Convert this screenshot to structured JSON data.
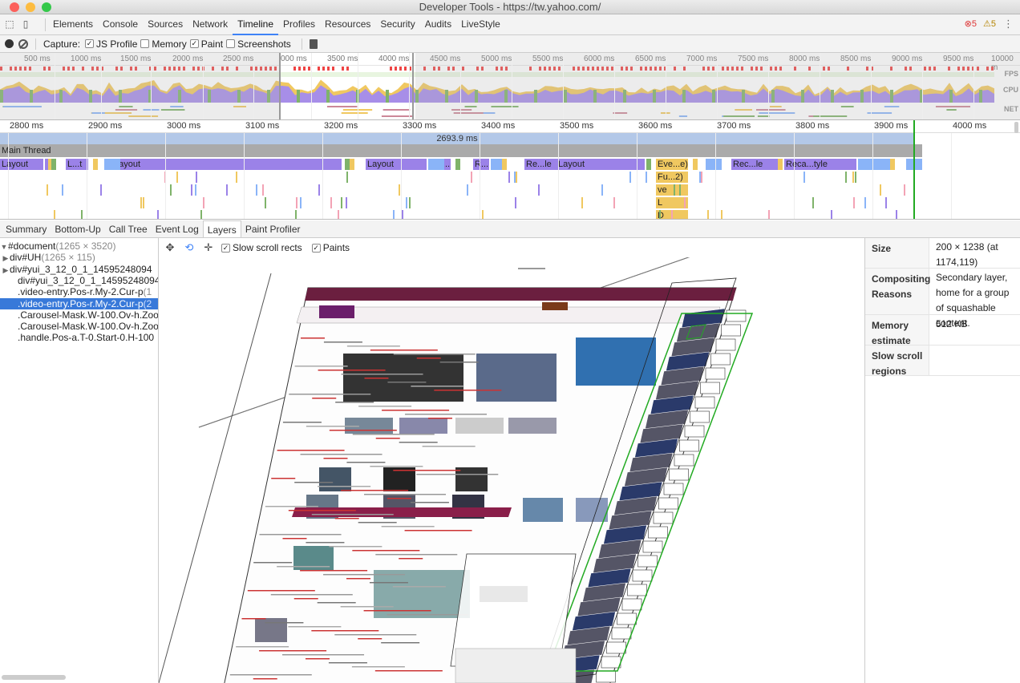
{
  "window": {
    "title": "Developer Tools - https://tw.yahoo.com/"
  },
  "colors": {
    "close": "#fc605b",
    "minimize": "#fdbc40",
    "zoom": "#34c84a",
    "accent": "#3e82f7",
    "layout": "#9b82e8",
    "scripting": "#f0c860",
    "rendering": "#8ab4f8"
  },
  "main_tabs": [
    {
      "label": "Elements"
    },
    {
      "label": "Console"
    },
    {
      "label": "Sources"
    },
    {
      "label": "Network"
    },
    {
      "label": "Timeline"
    },
    {
      "label": "Profiles"
    },
    {
      "label": "Resources"
    },
    {
      "label": "Security"
    },
    {
      "label": "Audits"
    },
    {
      "label": "LiveStyle"
    }
  ],
  "active_tab": "Timeline",
  "status": {
    "errors": "5",
    "warnings": "5"
  },
  "capture": {
    "label": "Capture:",
    "options": [
      {
        "label": "JS Profile",
        "checked": true
      },
      {
        "label": "Memory",
        "checked": false
      },
      {
        "label": "Paint",
        "checked": true
      },
      {
        "label": "Screenshots",
        "checked": false
      }
    ]
  },
  "overview": {
    "ticks": [
      "500 ms",
      "1000 ms",
      "1500 ms",
      "2000 ms",
      "2500 ms",
      "000 ms",
      "3500 ms",
      "4000 ms",
      "4500 ms",
      "5000 ms",
      "5500 ms",
      "6000 ms",
      "6500 ms",
      "7000 ms",
      "7500 ms",
      "8000 ms",
      "8500 ms",
      "9000 ms",
      "9500 ms",
      "10000 m"
    ],
    "labels": {
      "fps": "FPS",
      "cpu": "CPU",
      "net": "NET"
    }
  },
  "flame": {
    "ticks": [
      "2800 ms",
      "2900 ms",
      "3000 ms",
      "3100 ms",
      "3200 ms",
      "3300 ms",
      "3400 ms",
      "3500 ms",
      "3600 ms",
      "3700 ms",
      "3800 ms",
      "3900 ms",
      "4000 ms"
    ],
    "range_label": "2693.9 ms",
    "thread_label": "Main Thread",
    "events": [
      "Layout",
      "L...t",
      "Layout",
      "Layout",
      "R...",
      "R...",
      "Re...le",
      "Layout",
      "Eve...e)",
      "Rec...le",
      "Reca...tyle",
      "Fu...2)",
      "ve",
      "L",
      "D"
    ]
  },
  "detail_tabs": [
    {
      "label": "Summary"
    },
    {
      "label": "Bottom-Up"
    },
    {
      "label": "Call Tree"
    },
    {
      "label": "Event Log"
    },
    {
      "label": "Layers"
    },
    {
      "label": "Paint Profiler"
    }
  ],
  "active_detail_tab": "Layers",
  "layer_tree": [
    {
      "arrow": "▼",
      "name": "#document",
      "dim": "(1265 × 3520)",
      "selected": false
    },
    {
      "arrow": "▶",
      "name": "div#UH",
      "dim": "(1265 × 115)",
      "selected": false
    },
    {
      "arrow": "▶",
      "name": "div#yui_3_12_0_1_14595248094",
      "dim": "",
      "selected": false
    },
    {
      "arrow": "",
      "name": "div#yui_3_12_0_1_14595248094",
      "dim": "",
      "selected": false
    },
    {
      "arrow": "",
      "name": ".video-entry.Pos-r.My-2.Cur-p",
      "dim": "(1",
      "selected": false
    },
    {
      "arrow": "",
      "name": ".video-entry.Pos-r.My-2.Cur-p",
      "dim": "(2",
      "selected": true
    },
    {
      "arrow": "",
      "name": ".Carousel-Mask.W-100.Ov-h.Zoo",
      "dim": "",
      "selected": false
    },
    {
      "arrow": "",
      "name": ".Carousel-Mask.W-100.Ov-h.Zoo",
      "dim": "",
      "selected": false
    },
    {
      "arrow": "",
      "name": ".handle.Pos-a.T-0.Start-0.H-100",
      "dim": "",
      "selected": false
    }
  ],
  "viewport": {
    "tools": [
      {
        "icon": "pan-icon",
        "glyph": "✥"
      },
      {
        "icon": "rotate-icon",
        "glyph": "⟲"
      },
      {
        "icon": "reset-icon",
        "glyph": "✛"
      }
    ],
    "options": [
      {
        "label": "Slow scroll rects",
        "checked": true
      },
      {
        "label": "Paints",
        "checked": true
      }
    ]
  },
  "details": [
    {
      "key": "Size",
      "value": "200 × 1238 (at 1174,119)"
    },
    {
      "key": "Compositing Reasons",
      "value": "Secondary layer, home for a group of squashable content."
    },
    {
      "key": "Memory estimate",
      "value": "512 KB"
    },
    {
      "key": "Slow scroll regions",
      "value": ""
    }
  ]
}
